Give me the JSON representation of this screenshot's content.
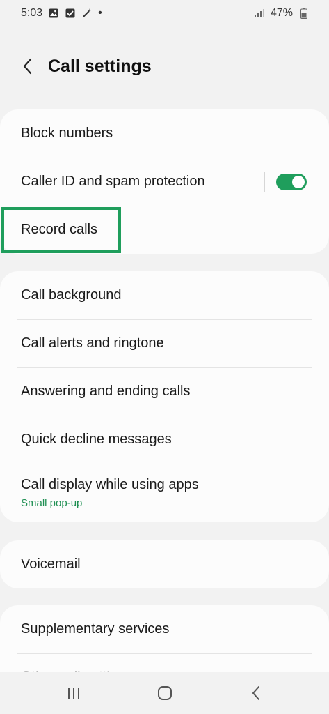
{
  "status_bar": {
    "time": "5:03",
    "battery_percent": "47%",
    "dot": "•",
    "left_icons": [
      "gallery-icon",
      "checkbox-icon",
      "magic-wand-icon"
    ],
    "right_icons": [
      "signal-icon",
      "battery-icon"
    ]
  },
  "header": {
    "title": "Call settings",
    "back_icon": "chevron-left-icon"
  },
  "groups": [
    {
      "items": [
        {
          "label": "Block numbers"
        },
        {
          "label": "Caller ID and spam protection",
          "toggle": true
        },
        {
          "label": "Record calls",
          "highlighted": true
        }
      ]
    },
    {
      "items": [
        {
          "label": "Call background"
        },
        {
          "label": "Call alerts and ringtone"
        },
        {
          "label": "Answering and ending calls"
        },
        {
          "label": "Quick decline messages"
        },
        {
          "label": "Call display while using apps",
          "subtitle": "Small pop-up"
        }
      ]
    },
    {
      "items": [
        {
          "label": "Voicemail"
        }
      ]
    },
    {
      "items": [
        {
          "label": "Supplementary services"
        },
        {
          "label": "Other call settings"
        }
      ]
    }
  ],
  "colors": {
    "accent": "#1f9e5c",
    "subtitle": "#1e8f52",
    "background": "#f2f2f2",
    "card": "#fcfcfc"
  },
  "nav_bar": {
    "icons": [
      "recent-apps-icon",
      "home-icon",
      "back-icon"
    ]
  }
}
